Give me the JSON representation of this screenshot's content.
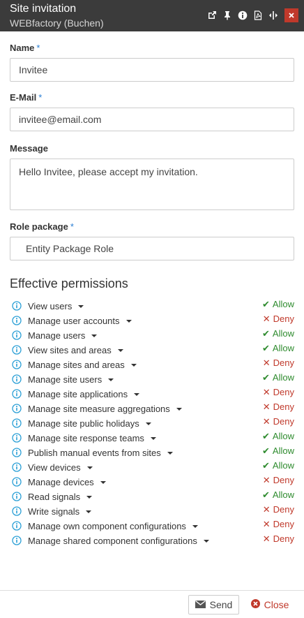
{
  "dialog": {
    "title": "Site invitation",
    "subtitle": "WEBfactory (Buchen)",
    "toolbar_icons": [
      "external-link-icon",
      "pin-icon",
      "info-icon",
      "pdf-icon",
      "resize-horizontal-icon",
      "close-icon"
    ]
  },
  "form": {
    "name": {
      "label": "Name",
      "required_mark": "*",
      "value": "Invitee"
    },
    "email": {
      "label": "E-Mail",
      "required_mark": "*",
      "value": "invitee@email.com"
    },
    "message": {
      "label": "Message",
      "value": "Hello Invitee, please accept my invitation."
    },
    "role_package": {
      "label": "Role package",
      "required_mark": "*",
      "value": "Entity Package Role"
    }
  },
  "permissions": {
    "title": "Effective permissions",
    "items": [
      {
        "name": "View users",
        "status": "Allow"
      },
      {
        "name": "Manage user accounts",
        "status": "Deny"
      },
      {
        "name": "Manage users",
        "status": "Allow"
      },
      {
        "name": "View sites and areas",
        "status": "Allow"
      },
      {
        "name": "Manage sites and areas",
        "status": "Deny"
      },
      {
        "name": "Manage site users",
        "status": "Allow"
      },
      {
        "name": "Manage site applications",
        "status": "Deny"
      },
      {
        "name": "Manage site measure aggregations",
        "status": "Deny"
      },
      {
        "name": "Manage site public holidays",
        "status": "Deny"
      },
      {
        "name": "Manage site response teams",
        "status": "Allow"
      },
      {
        "name": "Publish manual events from sites",
        "status": "Allow"
      },
      {
        "name": "View devices",
        "status": "Allow"
      },
      {
        "name": "Manage devices",
        "status": "Deny"
      },
      {
        "name": "Read signals",
        "status": "Allow"
      },
      {
        "name": "Write signals",
        "status": "Deny"
      },
      {
        "name": "Manage own component configurations",
        "status": "Deny"
      },
      {
        "name": "Manage shared component configurations",
        "status": "Deny"
      }
    ]
  },
  "footer": {
    "send_label": "Send",
    "close_label": "Close"
  },
  "colors": {
    "titlebar": "#3b3b3b",
    "allow": "#2e8b2e",
    "deny": "#c0392b",
    "info": "#2a9fd6",
    "required": "#2a7fd4"
  }
}
